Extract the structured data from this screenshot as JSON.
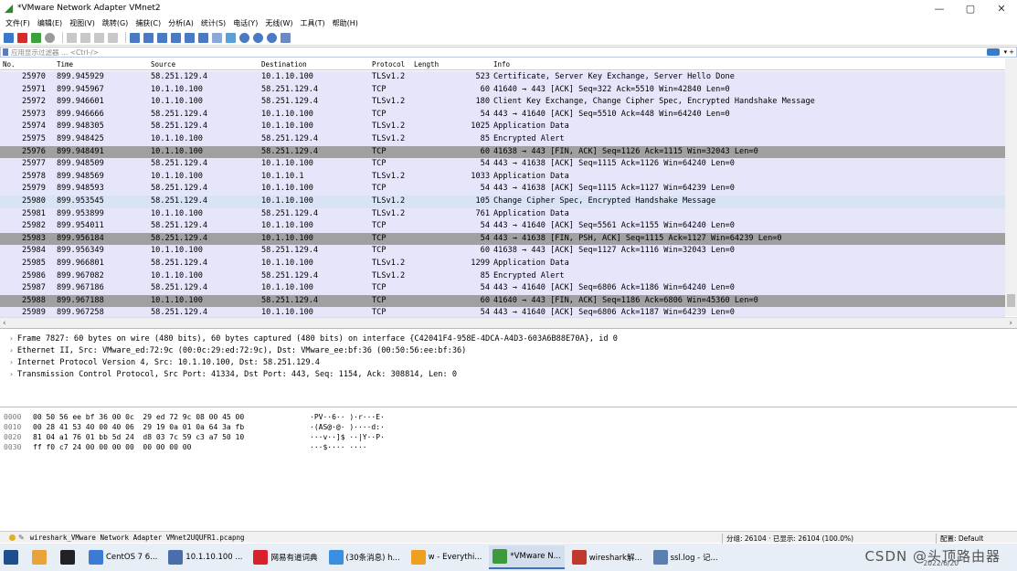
{
  "window": {
    "title": "*VMware Network Adapter VMnet2",
    "minimize": "—",
    "maximize": "▢",
    "close": "✕"
  },
  "menu": [
    "文件(F)",
    "编辑(E)",
    "视图(V)",
    "跳转(G)",
    "捕获(C)",
    "分析(A)",
    "统计(S)",
    "电话(Y)",
    "无线(W)",
    "工具(T)",
    "帮助(H)"
  ],
  "filter": {
    "placeholder": "应用显示过滤器 … <Ctrl-/>",
    "plus": "+"
  },
  "columns": {
    "no": "No.",
    "time": "Time",
    "source": "Source",
    "destination": "Destination",
    "protocol": "Protocol",
    "length": "Length",
    "info": "Info"
  },
  "packets": [
    {
      "no": "25970",
      "time": "899.945929",
      "src": "58.251.129.4",
      "dst": "10.1.10.100",
      "proto": "TLSv1.2",
      "len": "523",
      "info": "Certificate, Server Key Exchange, Server Hello Done",
      "style": "tls"
    },
    {
      "no": "25971",
      "time": "899.945967",
      "src": "10.1.10.100",
      "dst": "58.251.129.4",
      "proto": "TCP",
      "len": "60",
      "info": "41640 → 443 [ACK] Seq=322 Ack=5510 Win=42840 Len=0",
      "style": "tcp"
    },
    {
      "no": "25972",
      "time": "899.946601",
      "src": "10.1.10.100",
      "dst": "58.251.129.4",
      "proto": "TLSv1.2",
      "len": "180",
      "info": "Client Key Exchange, Change Cipher Spec, Encrypted Handshake Message",
      "style": "tls"
    },
    {
      "no": "25973",
      "time": "899.946666",
      "src": "58.251.129.4",
      "dst": "10.1.10.100",
      "proto": "TCP",
      "len": "54",
      "info": "443 → 41640 [ACK] Seq=5510 Ack=448 Win=64240 Len=0",
      "style": "tcp"
    },
    {
      "no": "25974",
      "time": "899.948305",
      "src": "58.251.129.4",
      "dst": "10.1.10.100",
      "proto": "TLSv1.2",
      "len": "1025",
      "info": "Application Data",
      "style": "tls"
    },
    {
      "no": "25975",
      "time": "899.948425",
      "src": "10.1.10.100",
      "dst": "58.251.129.4",
      "proto": "TLSv1.2",
      "len": "85",
      "info": "Encrypted Alert",
      "style": "tls"
    },
    {
      "no": "25976",
      "time": "899.948491",
      "src": "10.1.10.100",
      "dst": "58.251.129.4",
      "proto": "TCP",
      "len": "60",
      "info": "41638 → 443 [FIN, ACK] Seq=1126 Ack=1115 Win=32043 Len=0",
      "style": "fin"
    },
    {
      "no": "25977",
      "time": "899.948509",
      "src": "58.251.129.4",
      "dst": "10.1.10.100",
      "proto": "TCP",
      "len": "54",
      "info": "443 → 41638 [ACK] Seq=1115 Ack=1126 Win=64240 Len=0",
      "style": "tcp"
    },
    {
      "no": "25978",
      "time": "899.948569",
      "src": "10.1.10.100",
      "dst": "10.1.10.1",
      "proto": "TLSv1.2",
      "len": "1033",
      "info": "Application Data",
      "style": "tls"
    },
    {
      "no": "25979",
      "time": "899.948593",
      "src": "58.251.129.4",
      "dst": "10.1.10.100",
      "proto": "TCP",
      "len": "54",
      "info": "443 → 41638 [ACK] Seq=1115 Ack=1127 Win=64239 Len=0",
      "style": "tcp"
    },
    {
      "no": "25980",
      "time": "899.953545",
      "src": "58.251.129.4",
      "dst": "10.1.10.100",
      "proto": "TLSv1.2",
      "len": "105",
      "info": "Change Cipher Spec, Encrypted Handshake Message",
      "style": "sel"
    },
    {
      "no": "25981",
      "time": "899.953899",
      "src": "10.1.10.100",
      "dst": "58.251.129.4",
      "proto": "TLSv1.2",
      "len": "761",
      "info": "Application Data",
      "style": "tls"
    },
    {
      "no": "25982",
      "time": "899.954011",
      "src": "58.251.129.4",
      "dst": "10.1.10.100",
      "proto": "TCP",
      "len": "54",
      "info": "443 → 41640 [ACK] Seq=5561 Ack=1155 Win=64240 Len=0",
      "style": "tcp"
    },
    {
      "no": "25983",
      "time": "899.956184",
      "src": "58.251.129.4",
      "dst": "10.1.10.100",
      "proto": "TCP",
      "len": "54",
      "info": "443 → 41638 [FIN, PSH, ACK] Seq=1115 Ack=1127 Win=64239 Len=0",
      "style": "fin"
    },
    {
      "no": "25984",
      "time": "899.956349",
      "src": "10.1.10.100",
      "dst": "58.251.129.4",
      "proto": "TCP",
      "len": "60",
      "info": "41638 → 443 [ACK] Seq=1127 Ack=1116 Win=32043 Len=0",
      "style": "tcp"
    },
    {
      "no": "25985",
      "time": "899.966801",
      "src": "58.251.129.4",
      "dst": "10.1.10.100",
      "proto": "TLSv1.2",
      "len": "1299",
      "info": "Application Data",
      "style": "tls"
    },
    {
      "no": "25986",
      "time": "899.967082",
      "src": "10.1.10.100",
      "dst": "58.251.129.4",
      "proto": "TLSv1.2",
      "len": "85",
      "info": "Encrypted Alert",
      "style": "tls"
    },
    {
      "no": "25987",
      "time": "899.967186",
      "src": "58.251.129.4",
      "dst": "10.1.10.100",
      "proto": "TCP",
      "len": "54",
      "info": "443 → 41640 [ACK] Seq=6806 Ack=1186 Win=64240 Len=0",
      "style": "tcp"
    },
    {
      "no": "25988",
      "time": "899.967188",
      "src": "10.1.10.100",
      "dst": "58.251.129.4",
      "proto": "TCP",
      "len": "60",
      "info": "41640 → 443 [FIN, ACK] Seq=1186 Ack=6806 Win=45360 Len=0",
      "style": "fin"
    },
    {
      "no": "25989",
      "time": "899.967258",
      "src": "58.251.129.4",
      "dst": "10.1.10.100",
      "proto": "TCP",
      "len": "54",
      "info": "443 → 41640 [ACK] Seq=6806 Ack=1187 Win=64239 Len=0",
      "style": "tcp"
    }
  ],
  "row_colors": {
    "tls": "#e6e6fa",
    "tcp": "#e6e6fa",
    "fin": "#a0a0a0",
    "sel": "#d8e4f4"
  },
  "details": [
    "Frame 7827: 60 bytes on wire (480 bits), 60 bytes captured (480 bits) on interface {C42041F4-958E-4DCA-A4D3-603A6B88E70A}, id 0",
    "Ethernet II, Src: VMware_ed:72:9c (00:0c:29:ed:72:9c), Dst: VMware_ee:bf:36 (00:50:56:ee:bf:36)",
    "Internet Protocol Version 4, Src: 10.1.10.100, Dst: 58.251.129.4",
    "Transmission Control Protocol, Src Port: 41334, Dst Port: 443, Seq: 1154, Ack: 308814, Len: 0"
  ],
  "bytes": [
    {
      "off": "0000",
      "hex": "00 50 56 ee bf 36 00 0c  29 ed 72 9c 08 00 45 00",
      "ascii": "·PV··6·· )·r···E·"
    },
    {
      "off": "0010",
      "hex": "00 28 41 53 40 00 40 06  29 19 0a 01 0a 64 3a fb",
      "ascii": "·(AS@·@· )····d:·"
    },
    {
      "off": "0020",
      "hex": "81 04 a1 76 01 bb 5d 24  d8 03 7c 59 c3 a7 50 10",
      "ascii": "···v··]$ ··|Y··P·"
    },
    {
      "off": "0030",
      "hex": "ff f0 c7 24 00 00 00 00  00 00 00 00",
      "ascii": "···$···· ····"
    }
  ],
  "status": {
    "file": "wireshark_VMware Network Adapter VMnet2UQUFR1.pcapng",
    "stats": "分组: 26104 · 已显示: 26104 (100.0%)",
    "profile": "配置: Default"
  },
  "taskbar": [
    {
      "label": "",
      "color": "#1f4e8c"
    },
    {
      "label": "",
      "color": "#e8a33a"
    },
    {
      "label": "",
      "color": "#222222"
    },
    {
      "label": "CentOS 7 6...",
      "color": "#3b7bd4"
    },
    {
      "label": "10.1.10.100 ...",
      "color": "#4a6ea9"
    },
    {
      "label": "网易有道词典",
      "color": "#d8212c"
    },
    {
      "label": "(30条消息) h...",
      "color": "#3a8fe0"
    },
    {
      "label": "w - Everythi...",
      "color": "#f0a020"
    },
    {
      "label": "*VMware N...",
      "color": "#3c9a3c",
      "active": true
    },
    {
      "label": "wireshark解...",
      "color": "#c0392b"
    },
    {
      "label": "ssl.log - 记...",
      "color": "#5a7fb0"
    }
  ],
  "tray": {
    "text": "CSDN @头顶路由器",
    "date": "2022/6/20"
  }
}
